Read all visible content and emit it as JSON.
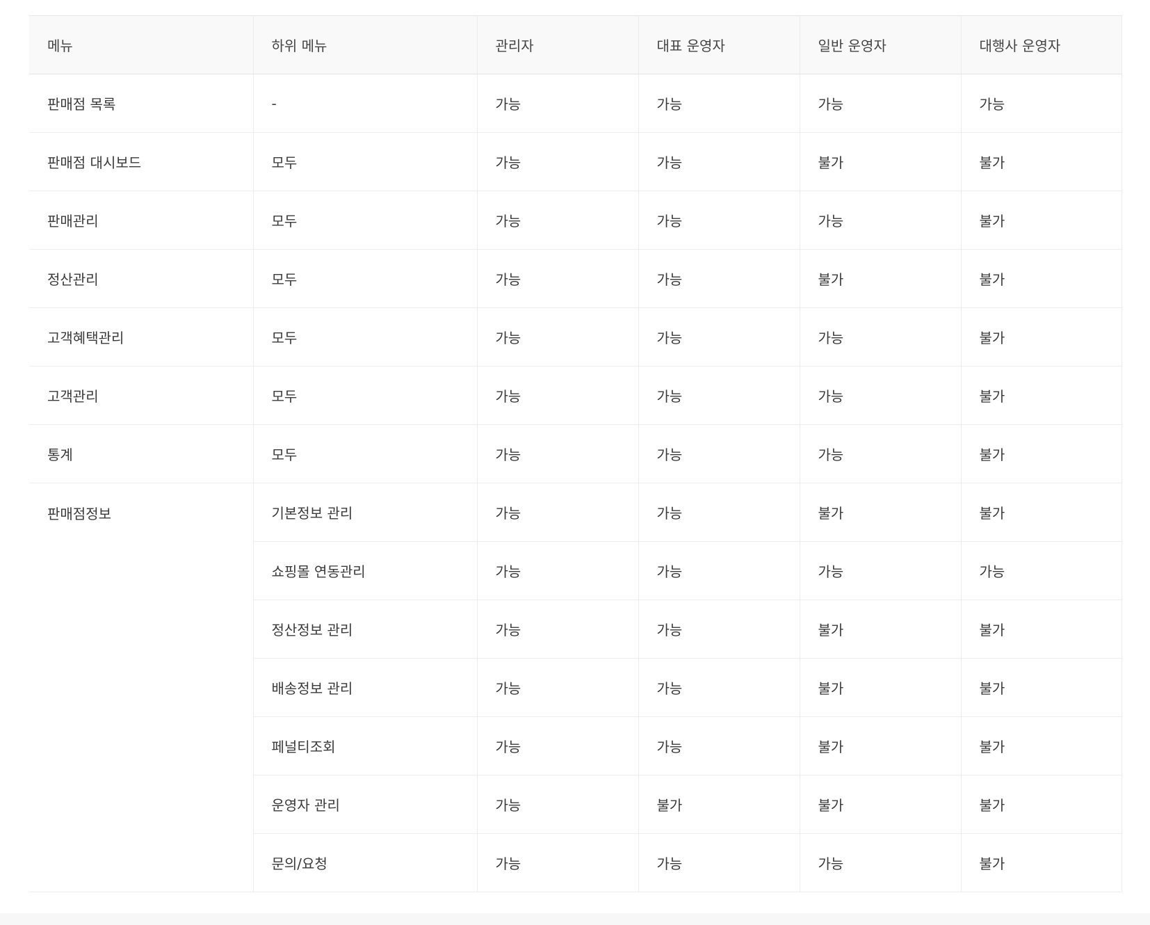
{
  "table": {
    "headers": [
      "메뉴",
      "하위 메뉴",
      "관리자",
      "대표 운영자",
      "일반 운영자",
      "대행사 운영자"
    ],
    "rows": [
      {
        "menu": "판매점 목록",
        "sub": "-",
        "roles": [
          "가능",
          "가능",
          "가능",
          "가능"
        ]
      },
      {
        "menu": "판매점 대시보드",
        "sub": "모두",
        "roles": [
          "가능",
          "가능",
          "불가",
          "불가"
        ]
      },
      {
        "menu": "판매관리",
        "sub": "모두",
        "roles": [
          "가능",
          "가능",
          "가능",
          "불가"
        ]
      },
      {
        "menu": "정산관리",
        "sub": "모두",
        "roles": [
          "가능",
          "가능",
          "불가",
          "불가"
        ]
      },
      {
        "menu": "고객혜택관리",
        "sub": "모두",
        "roles": [
          "가능",
          "가능",
          "가능",
          "불가"
        ]
      },
      {
        "menu": "고객관리",
        "sub": "모두",
        "roles": [
          "가능",
          "가능",
          "가능",
          "불가"
        ]
      },
      {
        "menu": "통계",
        "sub": "모두",
        "roles": [
          "가능",
          "가능",
          "가능",
          "불가"
        ]
      }
    ],
    "group": {
      "menu": "판매점정보",
      "rows": [
        {
          "sub": "기본정보 관리",
          "roles": [
            "가능",
            "가능",
            "불가",
            "불가"
          ]
        },
        {
          "sub": "쇼핑몰 연동관리",
          "roles": [
            "가능",
            "가능",
            "가능",
            "가능"
          ]
        },
        {
          "sub": "정산정보 관리",
          "roles": [
            "가능",
            "가능",
            "불가",
            "불가"
          ]
        },
        {
          "sub": "배송정보 관리",
          "roles": [
            "가능",
            "가능",
            "불가",
            "불가"
          ]
        },
        {
          "sub": "페널티조회",
          "roles": [
            "가능",
            "가능",
            "불가",
            "불가"
          ]
        },
        {
          "sub": "운영자 관리",
          "roles": [
            "가능",
            "불가",
            "불가",
            "불가"
          ]
        },
        {
          "sub": "문의/요청",
          "roles": [
            "가능",
            "가능",
            "가능",
            "불가"
          ]
        }
      ]
    }
  }
}
